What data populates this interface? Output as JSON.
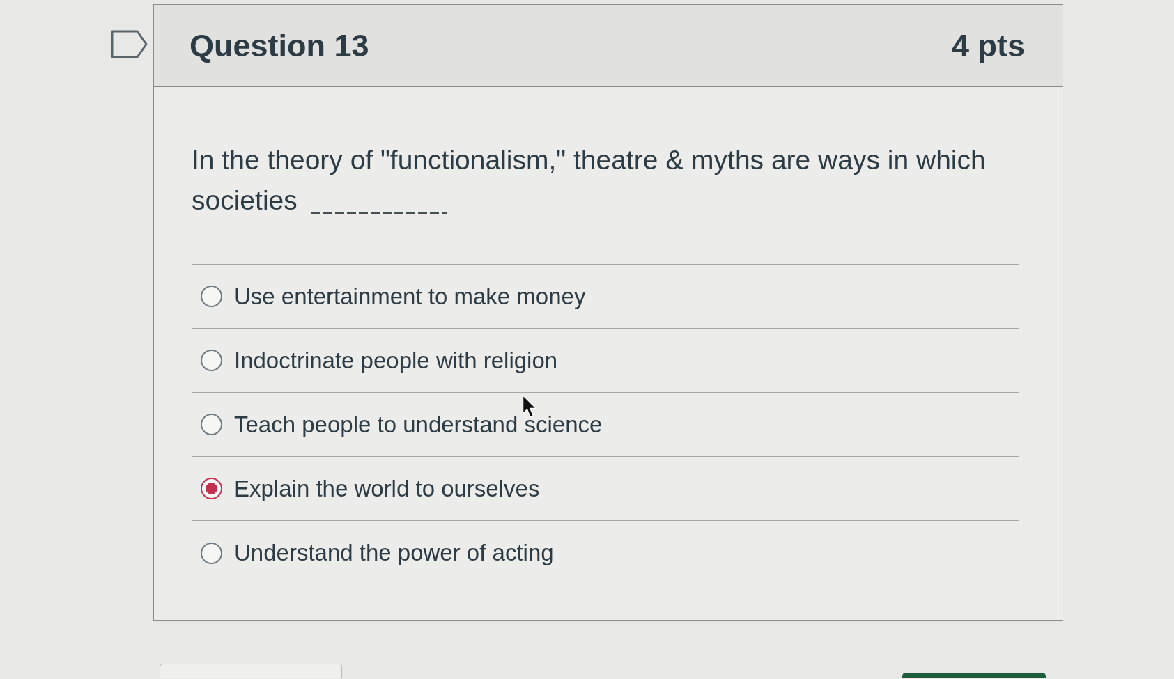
{
  "flag": {
    "flagged": false
  },
  "question": {
    "title": "Question 13",
    "points": "4 pts",
    "text": "In the theory of \"functionalism,\" theatre & myths are ways in which societies",
    "blank": true
  },
  "answers": [
    {
      "label": "Use entertainment to make money",
      "selected": false
    },
    {
      "label": "Indoctrinate people with religion",
      "selected": false
    },
    {
      "label": "Teach people to understand science",
      "selected": false
    },
    {
      "label": "Explain the world to ourselves",
      "selected": true
    },
    {
      "label": "Understand the power of acting",
      "selected": false
    }
  ],
  "footer": {
    "buttons": [
      {
        "kind": "secondary"
      },
      {
        "kind": "primary"
      }
    ]
  }
}
